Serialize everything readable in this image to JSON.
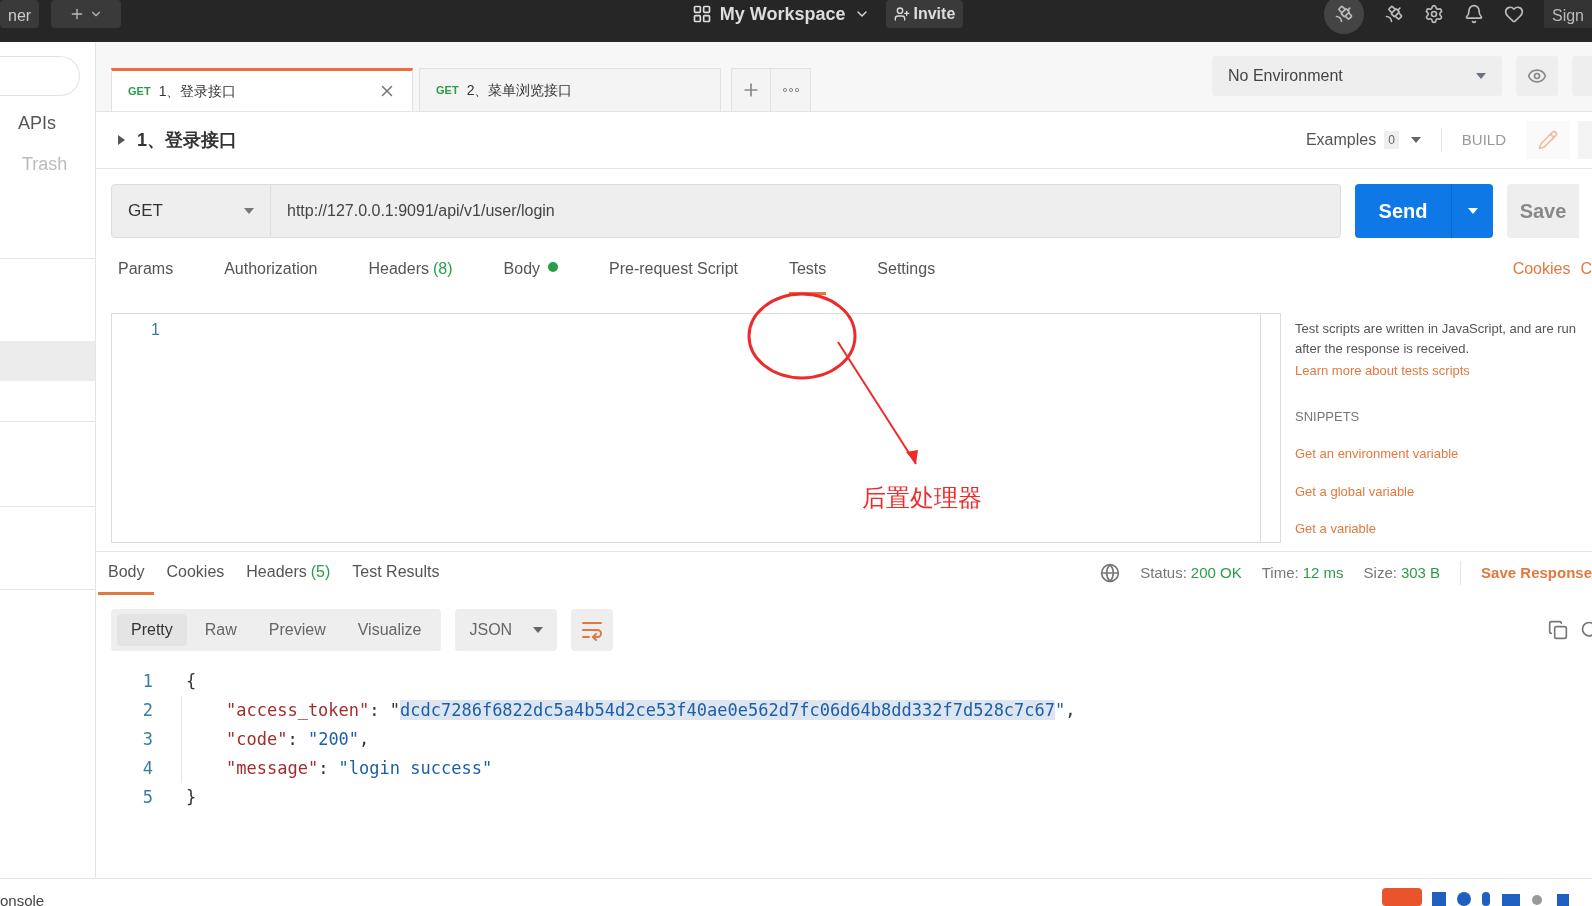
{
  "top_bar": {
    "left_cut": "ner",
    "workspace": "My Workspace",
    "invite": "Invite",
    "sign_cut": "Sign"
  },
  "sidebar": {
    "items": [
      {
        "label": "APIs",
        "disabled": false
      },
      {
        "label": "Trash",
        "disabled": true
      }
    ]
  },
  "request_tabs": [
    {
      "method": "GET",
      "name": "1、登录接口",
      "selected": true
    },
    {
      "method": "GET",
      "name": "2、菜单浏览接口",
      "selected": false
    }
  ],
  "environment": {
    "value": "No Environment"
  },
  "request": {
    "title": "1、登录接口",
    "examples_label": "Examples",
    "examples_count": "0",
    "build": "BUILD",
    "method": "GET",
    "url": "http://127.0.0.1:9091/api/v1/user/login",
    "send": "Send",
    "save": "Save"
  },
  "section_tabs": [
    {
      "label": "Params",
      "dot": false,
      "selected": false
    },
    {
      "label": "Authorization",
      "dot": false,
      "selected": false
    },
    {
      "label": "Headers",
      "count": "(8)",
      "dot": false,
      "selected": false
    },
    {
      "label": "Body",
      "dot": true,
      "selected": false
    },
    {
      "label": "Pre-request Script",
      "dot": false,
      "selected": false
    },
    {
      "label": "Tests",
      "dot": false,
      "selected": true
    },
    {
      "label": "Settings",
      "dot": false,
      "selected": false
    }
  ],
  "right_links": [
    "Cookies",
    "C"
  ],
  "editor": {
    "line_numbers": [
      "1"
    ]
  },
  "help": {
    "text": "Test scripts are written in JavaScript, and are run after the response is received.",
    "learn_more": "Learn more about tests scripts",
    "snippets_title": "SNIPPETS",
    "snippets": [
      "Get an environment variable",
      "Get a global variable",
      "Get a variable"
    ]
  },
  "annotation": {
    "text": "后置处理器"
  },
  "response_tabs": [
    {
      "label": "Body",
      "selected": true
    },
    {
      "label": "Cookies",
      "selected": false
    },
    {
      "label": "Headers",
      "count": "(5)",
      "selected": false
    },
    {
      "label": "Test Results",
      "selected": false
    }
  ],
  "response_meta": [
    {
      "label": "Status:",
      "value": "200 OK"
    },
    {
      "label": "Time:",
      "value": "12 ms"
    },
    {
      "label": "Size:",
      "value": "303 B"
    }
  ],
  "save_response": "Save Response",
  "view_modes": [
    {
      "label": "Pretty",
      "selected": true
    },
    {
      "label": "Raw",
      "selected": false
    },
    {
      "label": "Preview",
      "selected": false
    },
    {
      "label": "Visualize",
      "selected": false
    }
  ],
  "format": "JSON",
  "response_lines": [
    {
      "number": "1",
      "kind": "brace",
      "tokens": [
        {
          "kind": "punct",
          "text": "{",
          "selected": false
        }
      ]
    },
    {
      "number": "2",
      "kind": "member",
      "tokens": [
        {
          "kind": "key",
          "text": "\"access_token\"",
          "selected": false
        },
        {
          "kind": "punct",
          "text": ": \"",
          "selected": false
        },
        {
          "kind": "value",
          "text": "dcdc7286f6822dc5a4b54d2ce53f40ae0e562d7fc06d64b8dd332f7d528c7c67",
          "selected": true
        },
        {
          "kind": "value",
          "text": "\"",
          "selected": false
        },
        {
          "kind": "punct",
          "text": ",",
          "selected": false
        }
      ]
    },
    {
      "number": "3",
      "kind": "member",
      "tokens": [
        {
          "kind": "key",
          "text": "\"code\"",
          "selected": false
        },
        {
          "kind": "punct",
          "text": ": ",
          "selected": false
        },
        {
          "kind": "value",
          "text": "\"200\"",
          "selected": false
        },
        {
          "kind": "punct",
          "text": ",",
          "selected": false
        }
      ]
    },
    {
      "number": "4",
      "kind": "member",
      "tokens": [
        {
          "kind": "key",
          "text": "\"message\"",
          "selected": false
        },
        {
          "kind": "punct",
          "text": ": ",
          "selected": false
        },
        {
          "kind": "value",
          "text": "\"login success\"",
          "selected": false
        }
      ]
    },
    {
      "number": "5",
      "kind": "brace",
      "tokens": [
        {
          "kind": "punct",
          "text": "}",
          "selected": false
        }
      ]
    }
  ],
  "status_bar": {
    "console_cut": "onsole"
  }
}
